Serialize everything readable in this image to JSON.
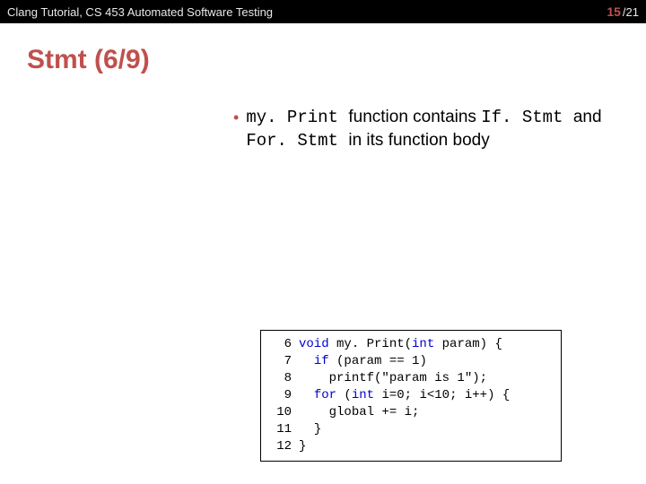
{
  "header": {
    "course": "Clang Tutorial, CS 453 Automated Software Testing",
    "page_current": "15",
    "page_total": " /21"
  },
  "title": "Stmt (6/9)",
  "bullet": {
    "pre": "my. Print ",
    "mid1": "function contains ",
    "kw1": "If. Stmt ",
    "mid2": "and ",
    "kw2": "For. Stmt ",
    "mid3": "in its function body"
  },
  "code": {
    "lines": [
      {
        "n": "6",
        "pre": "",
        "kw1": "void",
        "t1": " my. Print(",
        "kw2": "int",
        "t2": " param) {"
      },
      {
        "n": "7",
        "pre": "  ",
        "kw1": "if",
        "t1": " (param == 1)",
        "kw2": "",
        "t2": ""
      },
      {
        "n": "8",
        "pre": "    ",
        "kw1": "",
        "t1": "printf(\"param is 1\");",
        "kw2": "",
        "t2": ""
      },
      {
        "n": "9",
        "pre": "  ",
        "kw1": "for",
        "t1": " (",
        "kw2": "int",
        "t2": " i=0; i<10; i++) {"
      },
      {
        "n": "10",
        "pre": "    ",
        "kw1": "",
        "t1": "global += i;",
        "kw2": "",
        "t2": ""
      },
      {
        "n": "11",
        "pre": "  ",
        "kw1": "",
        "t1": "}",
        "kw2": "",
        "t2": ""
      },
      {
        "n": "12",
        "pre": "",
        "kw1": "",
        "t1": "}",
        "kw2": "",
        "t2": ""
      }
    ]
  }
}
